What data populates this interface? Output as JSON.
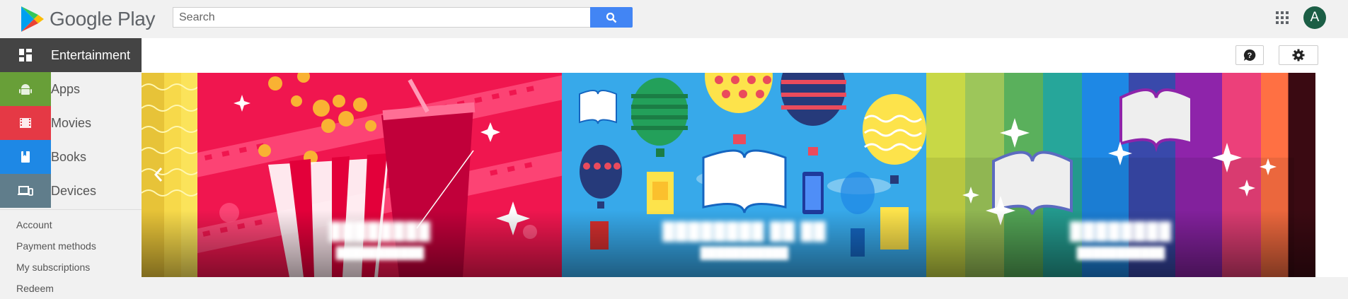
{
  "header": {
    "logo_text": "Google Play",
    "search_placeholder": "Search",
    "avatar_letter": "A"
  },
  "sidebar": {
    "items": [
      {
        "label": "Entertainment",
        "icon": "entertainment-grid-icon",
        "color": "#444444"
      },
      {
        "label": "Apps",
        "icon": "android-icon",
        "color": "#689f38"
      },
      {
        "label": "Movies",
        "icon": "film-icon",
        "color": "#e53945"
      },
      {
        "label": "Books",
        "icon": "book-icon",
        "color": "#1e88e5"
      },
      {
        "label": "Devices",
        "icon": "devices-icon",
        "color": "#607d8b"
      }
    ],
    "links": [
      "Account",
      "Payment methods",
      "My subscriptions",
      "Redeem"
    ]
  },
  "toolbar": {
    "help_icon": "help-icon",
    "settings_icon": "gear-icon"
  },
  "carousel": {
    "cards": [
      {
        "theme": "popcorn-movies",
        "title": "████████",
        "subtitle": "███████████"
      },
      {
        "theme": "hot-air-balloon-books",
        "title": "████████ ██ ██",
        "subtitle": "███████████"
      },
      {
        "theme": "rainbow-books",
        "title": "████████",
        "subtitle": "███████████"
      }
    ],
    "prev_icon": "chevron-left-icon",
    "next_icon": "chevron-right-icon"
  },
  "colors": {
    "accent_blue": "#4285f4",
    "avatar_bg": "#1b5e45",
    "popcorn_red": "#f0164f",
    "sky_blue": "#37a9ea"
  }
}
